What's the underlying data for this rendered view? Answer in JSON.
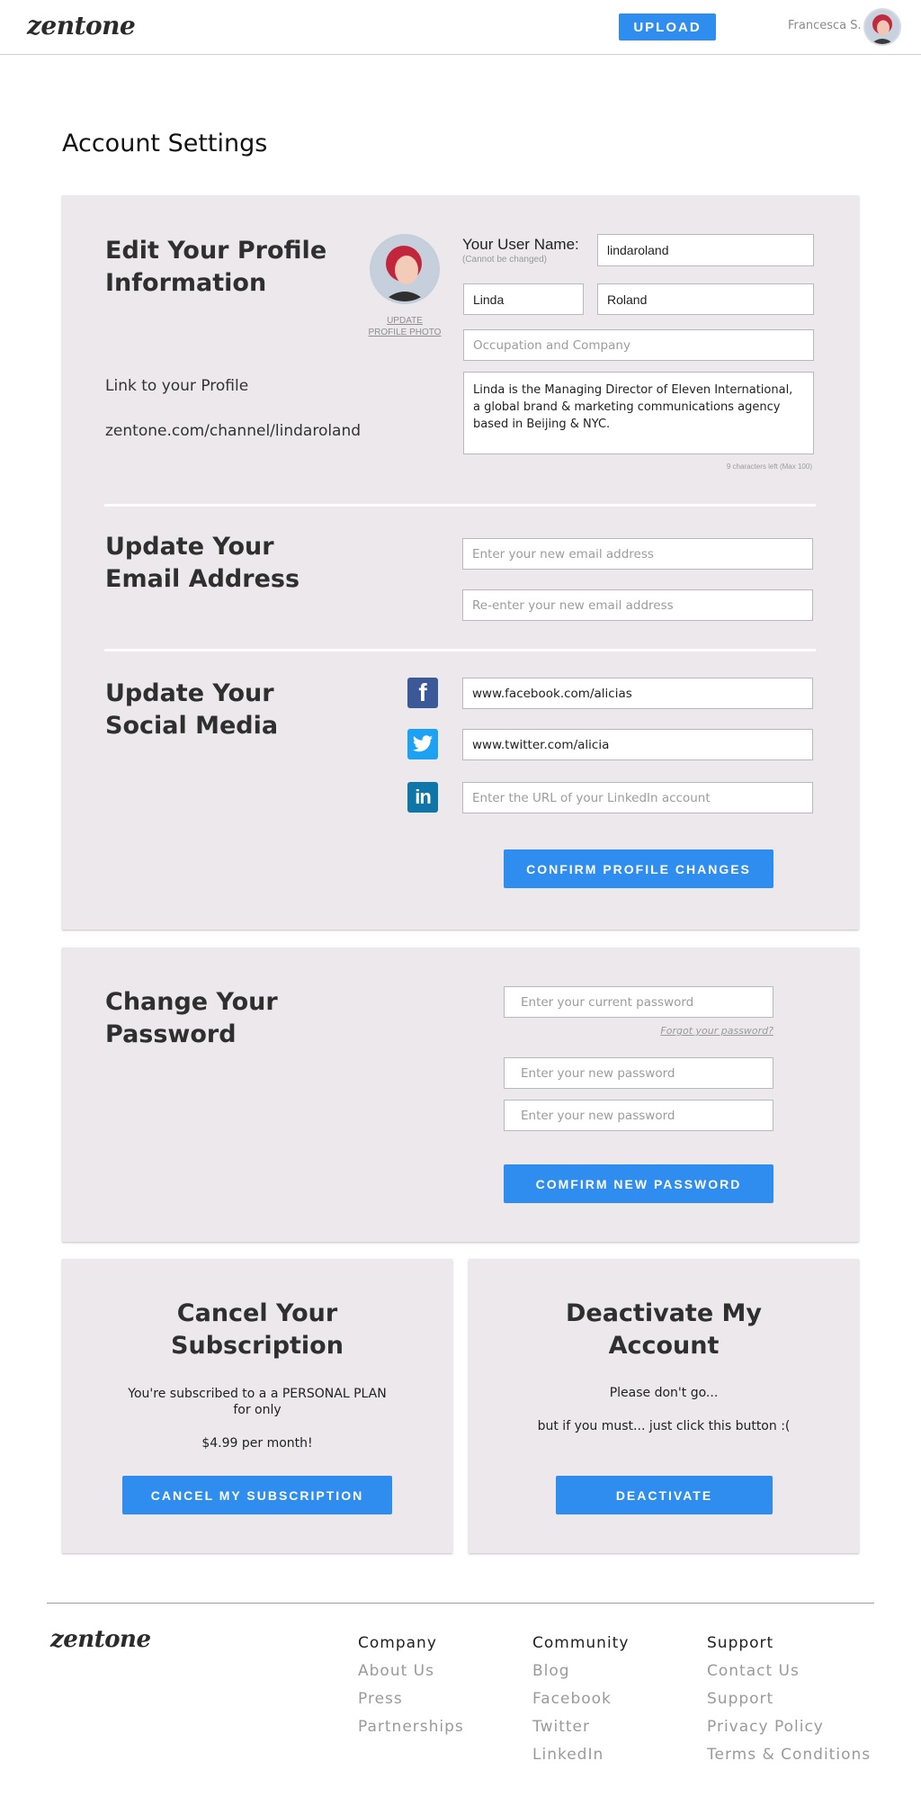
{
  "header": {
    "logo": "zentone",
    "upload_label": "UPLOAD",
    "user_name": "Francesca S."
  },
  "page_title": "Account Settings",
  "profile": {
    "heading_line1": "Edit Your Profile",
    "heading_line2": "Information",
    "update_photo_line1": "UPDATE",
    "update_photo_line2": "PROFILE PHOTO",
    "username_label": "Your User Name:",
    "username_note": "(Cannot be changed)",
    "username_value": "lindaroland",
    "first_name": "Linda",
    "last_name": "Roland",
    "occupation_placeholder": "Occupation and Company",
    "bio_line1": "Linda is the Managing Director of Eleven International,",
    "bio_line2": "a global brand & marketing communications agency",
    "bio_line3": "based in Beijing & NYC.",
    "chars_left": "9 characters left (Max 100)",
    "link_label": "Link to your Profile",
    "link_value": "zentone.com/channel/lindaroland"
  },
  "email": {
    "heading_line1": "Update Your",
    "heading_line2": "Email Address",
    "new_placeholder": "Enter your new email address",
    "confirm_placeholder": "Re-enter your new email address"
  },
  "social": {
    "heading_line1": "Update Your",
    "heading_line2": "Social Media",
    "facebook_value": "www.facebook.com/alicias",
    "twitter_value": "www.twitter.com/alicia",
    "linkedin_placeholder": "Enter the URL of your LinkedIn account",
    "confirm_label": "CONFIRM PROFILE CHANGES"
  },
  "password": {
    "heading_line1": "Change Your",
    "heading_line2": "Password",
    "current_placeholder": "Enter your current password",
    "forgot_label": "Forgot your password?",
    "new_placeholder": "Enter your new password",
    "repeat_placeholder": "Enter your new password",
    "confirm_label": "COMFIRM NEW PASSWORD"
  },
  "subscription": {
    "heading_line1": "Cancel Your",
    "heading_line2": "Subscription",
    "text_line1": "You're subscribed to a a PERSONAL PLAN",
    "text_line2": "for only",
    "price": "$4.99 per month!",
    "button_label": "CANCEL MY SUBSCRIPTION"
  },
  "deactivate": {
    "heading_line1": "Deactivate My",
    "heading_line2": "Account",
    "text_line1": "Please don't go...",
    "text_line2": "but if you must... just click this button :(",
    "button_label": "DEACTIVATE"
  },
  "footer": {
    "logo": "zentone",
    "columns": [
      {
        "title": "Company",
        "links": [
          "About Us",
          "Press",
          "Partnerships"
        ]
      },
      {
        "title": "Community",
        "links": [
          "Blog",
          "Facebook",
          "Twitter",
          "LinkedIn"
        ]
      },
      {
        "title": "Support",
        "links": [
          "Contact Us",
          "Support",
          "Privacy Policy",
          "Terms & Conditions"
        ]
      }
    ]
  },
  "colors": {
    "accent": "#2f8df0",
    "panel": "#ece8ec",
    "facebook": "#3b5998",
    "twitter": "#1da1f2",
    "linkedin": "#0e76a8"
  },
  "icons": {
    "facebook": "facebook-icon",
    "twitter": "twitter-icon",
    "linkedin": "linkedin-icon"
  }
}
